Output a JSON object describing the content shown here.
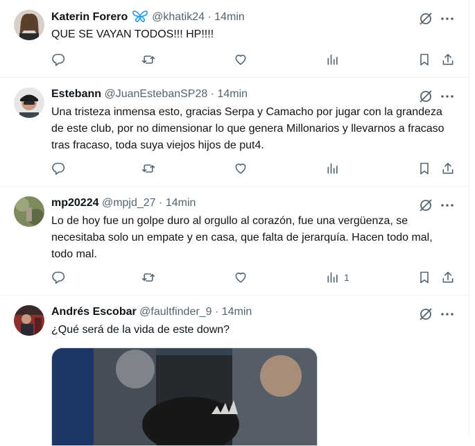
{
  "tweets": [
    {
      "name": "Katerin Forero",
      "badge": "butterfly",
      "handle": "@khatik24",
      "dot": "·",
      "time": "14min",
      "text": "QUE SE VAYAN TODOS!!! HP!!!!",
      "views": ""
    },
    {
      "name": "Estebann",
      "handle": "@JuanEstebanSP28",
      "dot": "·",
      "time": "14min",
      "text": "Una tristeza inmensa esto, gracias Serpa y Camacho por jugar con la grandeza de este club, por no dimensionar lo que genera Millonarios y llevarnos a fracaso tras fracaso, toda suya viejos hijos de put4.",
      "views": ""
    },
    {
      "name": "mp20224",
      "handle": "@mpjd_27",
      "dot": "·",
      "time": "14min",
      "text": "Lo de hoy fue un golpe duro al orgullo al corazón, fue una vergüenza, se necesitaba solo un empate y en casa, que falta de jerarquía. Hacen todo mal, todo mal.",
      "views": "1"
    },
    {
      "name": "Andrés Escobar",
      "handle": "@faultfinder_9",
      "dot": "·",
      "time": "14min",
      "text": "¿Qué será de la vida de este down?",
      "views": ""
    }
  ],
  "icons": {
    "reply": "reply-icon",
    "retweet": "retweet-icon",
    "like": "like-icon",
    "views": "views-icon",
    "bookmark": "bookmark-icon",
    "share": "share-icon",
    "grok": "grok-icon",
    "more": "more-icon"
  },
  "colors": {
    "text": "#0f1419",
    "muted": "#536471",
    "butterfly": "#1d9bf0",
    "border": "#eff3f4"
  }
}
